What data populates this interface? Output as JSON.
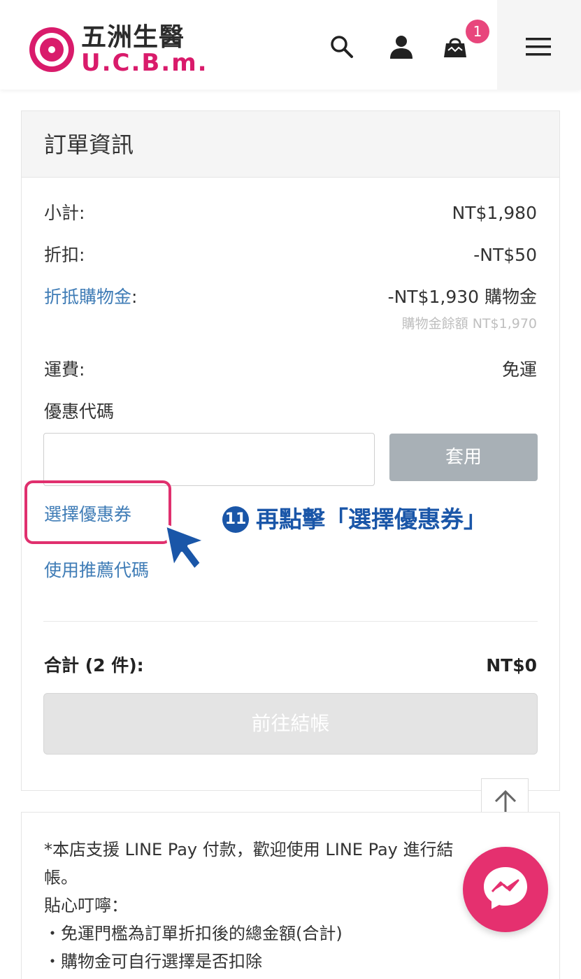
{
  "header": {
    "logo_cn": "五洲生醫",
    "logo_en": "U.C.B.m.",
    "cart_count": "1",
    "icons": [
      "search-icon",
      "user-icon",
      "cart-icon",
      "menu-icon"
    ]
  },
  "order": {
    "title": "訂單資訊",
    "subtotal_label": "小計:",
    "subtotal_value": "NT$1,980",
    "discount_label": "折扣:",
    "discount_value": "-NT$50",
    "credit_label": "折抵購物金",
    "credit_colon": ":",
    "credit_value": "-NT$1,930 購物金",
    "credit_balance": "購物金餘額 NT$1,970",
    "shipping_label": "運費:",
    "shipping_value": "免運",
    "coupon_label": "優惠代碼",
    "coupon_input_value": "",
    "apply_label": "套用",
    "choose_coupon_link": "選擇優惠券",
    "referral_link": "使用推薦代碼",
    "total_label": "合計 (2 件):",
    "total_value": "NT$0",
    "checkout_label": "前往結帳"
  },
  "annotation": {
    "step_number": "11",
    "step_text": "再點擊「選擇優惠券」"
  },
  "notice": {
    "lines": [
      "*本店支援 LINE Pay 付款，歡迎使用 LINE Pay 進行結",
      "帳。",
      "貼心叮嚀：",
      "・免運門檻為訂單折扣後的總金額(合計)",
      "・購物金可自行選擇是否扣除"
    ]
  },
  "colors": {
    "brand": "#d91b6b",
    "link": "#3f7cb6",
    "annotation": "#1a56a8",
    "highlight": "#e0306e",
    "badge": "#e8467c"
  }
}
